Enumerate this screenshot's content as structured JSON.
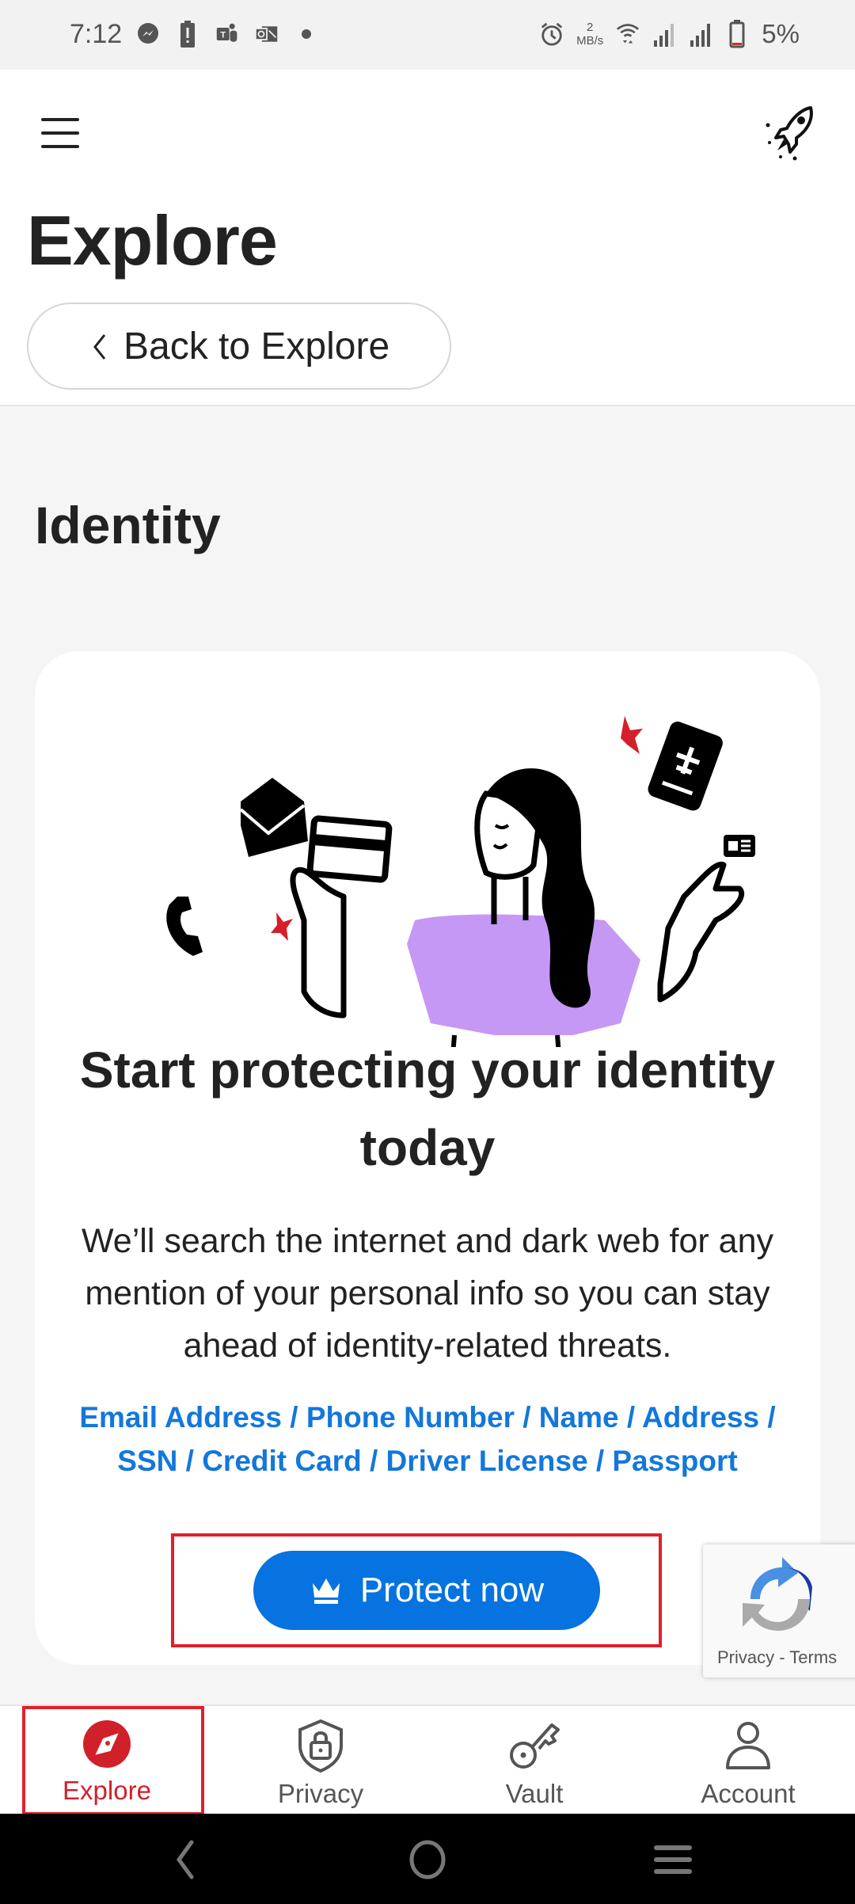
{
  "status_bar": {
    "time": "7:12",
    "notification_icons": [
      "messenger-icon",
      "battery-alert-icon",
      "teams-icon",
      "outlook-icon",
      "dot-icon"
    ],
    "speed_value": "2",
    "speed_unit": "MB/s",
    "battery_percent": "5%"
  },
  "header": {
    "title": "Explore",
    "back_label": "Back to Explore"
  },
  "section": {
    "title": "Identity"
  },
  "card": {
    "title": "Start protecting your identity today",
    "description": "We’ll search the internet and dark web for any mention of your personal info so you can stay ahead of identity-related threats.",
    "types_line1": "Email Address / Phone Number / Name / Address /",
    "types_line2": "SSN / Credit Card / Driver License / Passport",
    "cta_label": "Protect now"
  },
  "recaptcha": {
    "links": "Privacy - Terms"
  },
  "bottom_nav": {
    "items": [
      {
        "label": "Explore",
        "icon": "compass-icon",
        "active": true
      },
      {
        "label": "Privacy",
        "icon": "shield-lock-icon",
        "active": false
      },
      {
        "label": "Vault",
        "icon": "key-icon",
        "active": false
      },
      {
        "label": "Account",
        "icon": "person-icon",
        "active": false
      }
    ]
  },
  "colors": {
    "accent_blue": "#0673e0",
    "link_blue": "#1377db",
    "active_red": "#d0212b",
    "illustration_purple": "#c598f5"
  }
}
